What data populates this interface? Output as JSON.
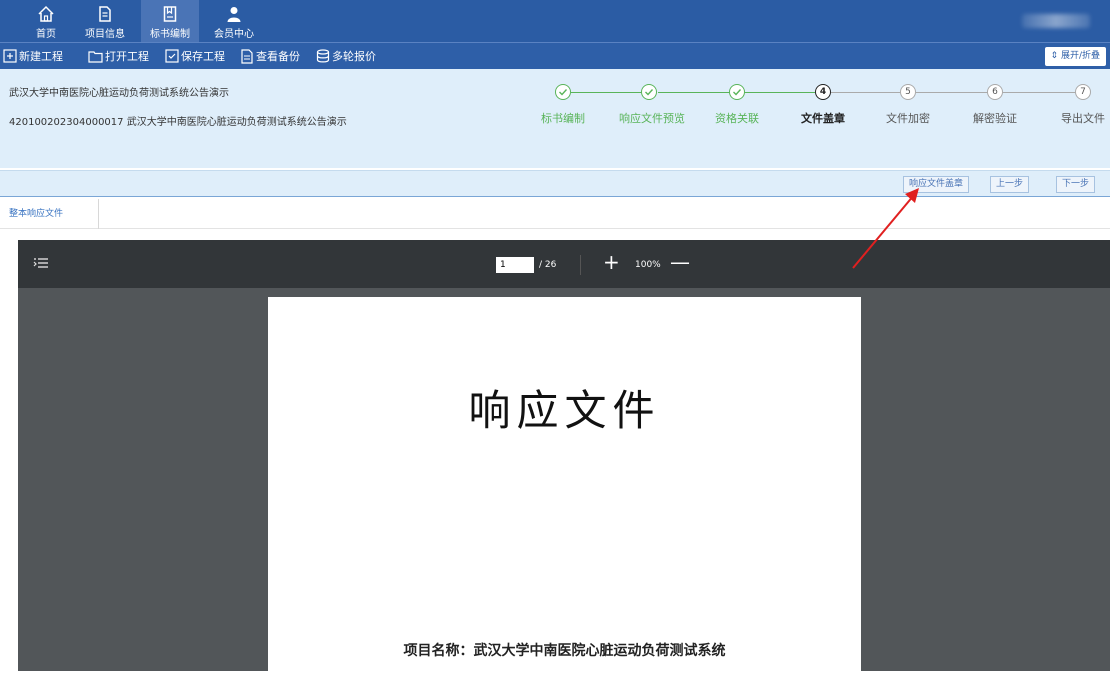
{
  "nav": {
    "items": [
      {
        "label": "首页",
        "icon": "home-icon"
      },
      {
        "label": "项目信息",
        "icon": "document-icon"
      },
      {
        "label": "标书编制",
        "icon": "book-icon"
      },
      {
        "label": "会员中心",
        "icon": "user-icon"
      }
    ],
    "active": "标书编制"
  },
  "toolbar": {
    "new_project": "新建工程",
    "open_project": "打开工程",
    "save_project": "保存工程",
    "view_backup": "查看备份",
    "multi_round_quote": "多轮报价",
    "expand_all": "展开/折叠"
  },
  "project": {
    "name": "武汉大学中南医院心脏运动负荷测试系统公告演示",
    "code_line": "420100202304000017 武汉大学中南医院心脏运动负荷测试系统公告演示"
  },
  "steps": [
    {
      "num": "✓",
      "label": "标书编制",
      "state": "done"
    },
    {
      "num": "✓",
      "label": "响应文件预览",
      "state": "done"
    },
    {
      "num": "✓",
      "label": "资格关联",
      "state": "done"
    },
    {
      "num": "4",
      "label": "文件盖章",
      "state": "current"
    },
    {
      "num": "5",
      "label": "文件加密",
      "state": "pending"
    },
    {
      "num": "6",
      "label": "解密验证",
      "state": "pending"
    },
    {
      "num": "7",
      "label": "导出文件",
      "state": "pending"
    }
  ],
  "actions": {
    "seal": "响应文件盖章",
    "prev": "上一步",
    "next": "下一步"
  },
  "tab": {
    "label": "整本响应文件"
  },
  "viewer": {
    "page_current": "1",
    "page_total": "/ 26",
    "zoom": "100%",
    "zoom_in": "+",
    "zoom_out": "—"
  },
  "document": {
    "title": "响应文件",
    "project_line": "项目名称：武汉大学中南医院心脏运动负荷测试系统"
  },
  "colors": {
    "nav_bg": "#2b5ca4",
    "info_bg": "#dfeefa",
    "done_green": "#59b459",
    "viewer_bg": "#525659",
    "arrow_red": "#e02020"
  }
}
